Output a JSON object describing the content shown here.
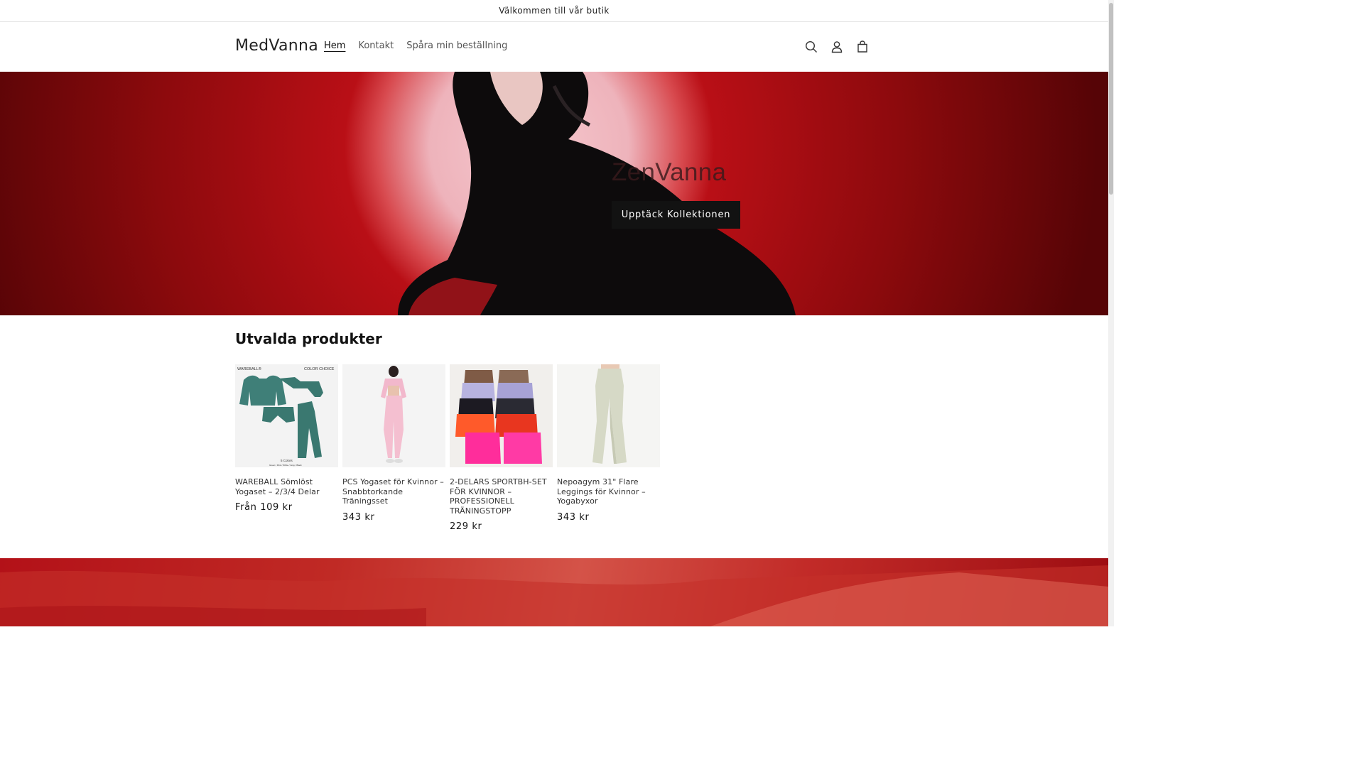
{
  "announcement": {
    "text": "Välkommen till vår butik"
  },
  "header": {
    "logo": "MedVanna",
    "nav": [
      {
        "label": "Hem",
        "active": true
      },
      {
        "label": "Kontakt",
        "active": false
      },
      {
        "label": "Spåra min beställning",
        "active": false
      }
    ],
    "icons": [
      "search-icon",
      "account-icon",
      "cart-icon"
    ]
  },
  "hero": {
    "title": "ZenVanna",
    "button_label": "Upptäck Kollektionen"
  },
  "featured": {
    "title": "Utvalda produkter",
    "products": [
      {
        "title": "WAREBALL Sömlöst Yogaset – 2/3/4 Delar",
        "price": "Från 109 kr",
        "image_brand": "WAREBALL®",
        "image_badge": "COLOR CHOICE",
        "image_caption": "5 Colors",
        "image_colors": "Green / Pink / White / Gray / Black"
      },
      {
        "title": "PCS Yogaset för Kvinnor – Snabbtorkande Träningsset",
        "price": "343 kr"
      },
      {
        "title": "2-DELARS SPORTBH-SET FÖR KVINNOR – PROFESSIONELL TRÄNINGSTOPP",
        "price": "229 kr"
      },
      {
        "title": "Nepoagym 31\" Flare Leggings för Kvinnor – Yogabyxor",
        "price": "343 kr"
      }
    ]
  },
  "colors": {
    "accent": "#121212",
    "hero_red": "#b90f16",
    "text_muted": "#555555"
  }
}
